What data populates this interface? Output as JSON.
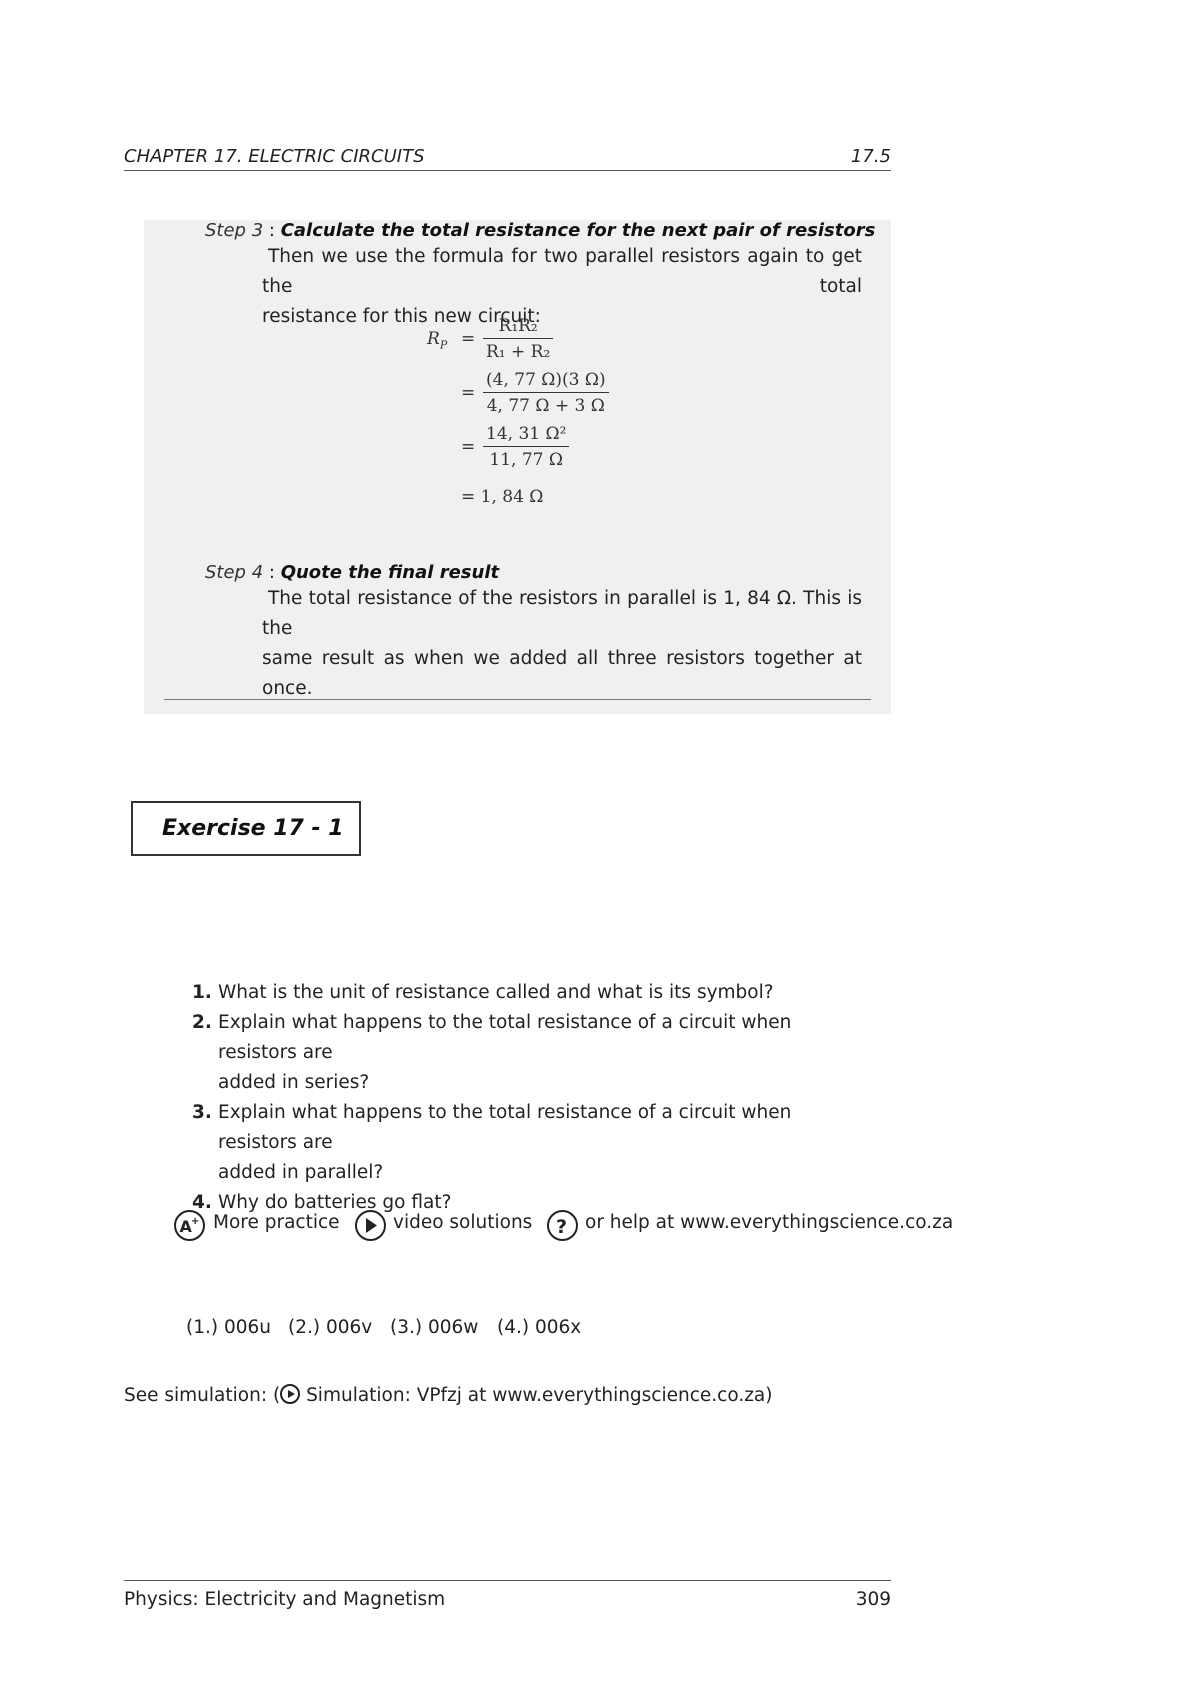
{
  "header": {
    "chapter": "CHAPTER 17.  ELECTRIC CIRCUITS",
    "section": "17.5"
  },
  "example": {
    "step3": {
      "label": "Step 3",
      "separator": " : ",
      "title": "Calculate the total resistance for the next pair of resistors",
      "text_line1": "Then we use the formula for two parallel resistors again to get the total",
      "text_line2": "resistance for this new circuit:"
    },
    "equation": {
      "lhs_symbol": "R",
      "lhs_subscript": "P",
      "eq_sign": "=",
      "line1_numerator": "R₁R₂",
      "line1_denominator": "R₁ + R₂",
      "line2_numerator": "(4, 77 Ω)(3 Ω)",
      "line2_denominator": "4, 77 Ω + 3 Ω",
      "line3_numerator": "14, 31 Ω²",
      "line3_denominator": "11, 77 Ω",
      "line4": "= 1, 84 Ω"
    },
    "step4": {
      "label": "Step 4",
      "separator": " : ",
      "title": "Quote the final result",
      "text_line1": "The total resistance of the resistors in parallel is 1, 84 Ω.  This is the",
      "text_line2": "same result as when we added all three resistors together at once."
    }
  },
  "exercise": {
    "title": "Exercise 17  - 1",
    "questions": [
      {
        "num": "1.",
        "lines": [
          "What is the unit of resistance called and what is its symbol?"
        ]
      },
      {
        "num": "2.",
        "lines": [
          "Explain what happens to the total resistance of a circuit when resistors are",
          "added in series?"
        ]
      },
      {
        "num": "3.",
        "lines": [
          "Explain what happens to the total resistance of a circuit when resistors are",
          "added in parallel?"
        ]
      },
      {
        "num": "4.",
        "lines": [
          "Why do batteries go flat?"
        ]
      }
    ]
  },
  "practice": {
    "more_practice": "More practice",
    "video_solutions": "video solutions",
    "help": "or help at www.everythingscience.co.za",
    "icons": [
      "a-plus-icon",
      "play-icon",
      "question-icon"
    ]
  },
  "codes": [
    "(1.) 006u",
    "(2.) 006v",
    "(3.) 006w",
    "(4.) 006x"
  ],
  "simulation": {
    "prefix": "See simulation: (",
    "text": "Simulation: VPfzj at www.everythingscience.co.za)"
  },
  "footer": {
    "book": "Physics: Electricity and Magnetism",
    "page": "309"
  }
}
